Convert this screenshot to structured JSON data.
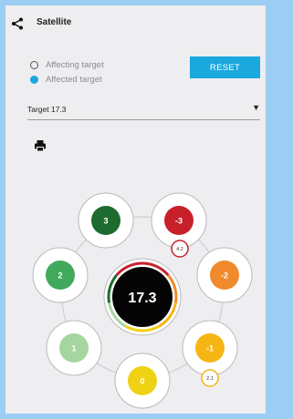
{
  "header": {
    "title": "Satellite",
    "share_icon": "share-icon"
  },
  "options": {
    "affecting_label": "Affecting target",
    "affected_label": "Affected target",
    "selected": "affected",
    "reset_label": "RESET"
  },
  "target_select": {
    "value": "Target 17.3",
    "arrow": "▼"
  },
  "toolbar": {
    "print_icon": "print-icon"
  },
  "wheel": {
    "center_value": "17.3",
    "nodes": [
      {
        "label": "3",
        "color": "#1d6b2e",
        "badge": ""
      },
      {
        "label": "-3",
        "color": "#c8202b",
        "badge": "4.2"
      },
      {
        "label": "2",
        "color": "#41a95b",
        "badge": ""
      },
      {
        "label": "-2",
        "color": "#f08a2c",
        "badge": ""
      },
      {
        "label": "1",
        "color": "#a6d6a0",
        "badge": ""
      },
      {
        "label": "-1",
        "color": "#f5b512",
        "badge": "2.1"
      },
      {
        "label": "0",
        "color": "#efd214",
        "badge": ""
      }
    ],
    "badge_colors": {
      "-3": "#c8202b",
      "-1": "#f5b512"
    }
  },
  "colors": {
    "accent": "#1aa8dd",
    "frame": "#9ccdf2",
    "panel": "#eeeef1"
  }
}
